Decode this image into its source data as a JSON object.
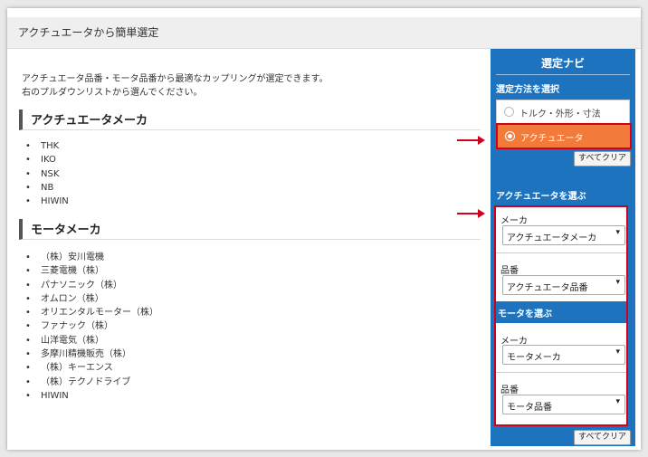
{
  "page": {
    "title": "アクチュエータから簡単選定",
    "intro_lines": [
      "アクチュエータ品番・モータ品番から最適なカップリングが選定できます。",
      "右のプルダウンリストから選んでください。"
    ]
  },
  "actuator_makers": {
    "heading": "アクチュエータメーカ",
    "items": [
      "THK",
      "IKO",
      "NSK",
      "NB",
      "HIWIN"
    ]
  },
  "motor_makers": {
    "heading": "モータメーカ",
    "items": [
      "（株）安川電機",
      "三菱電機（株）",
      "パナソニック（株）",
      "オムロン（株）",
      "オリエンタルモーター（株）",
      "ファナック（株）",
      "山洋電気（株）",
      "多摩川精機販売（株）",
      "（株）キーエンス",
      "（株）テクノドライブ",
      "HIWIN"
    ]
  },
  "nav": {
    "title": "選定ナビ",
    "method_heading": "選定方法を選択",
    "method_options": [
      "トルク・外形・寸法",
      "アクチュエータ"
    ],
    "selected_method": "アクチュエータ",
    "clear_label": "すべてクリア",
    "actuator_heading": "アクチュエータを選ぶ",
    "actuator_maker_label": "メーカ",
    "actuator_maker_value": "アクチュエータメーカ",
    "actuator_part_label": "品番",
    "actuator_part_value": "アクチュエータ品番",
    "motor_heading": "モータを選ぶ",
    "motor_maker_label": "メーカ",
    "motor_maker_value": "モータメーカ",
    "motor_part_label": "品番",
    "motor_part_value": "モータ品番"
  },
  "colors": {
    "panel_blue": "#1e73be",
    "selected_orange": "#f27b3c",
    "highlight_red": "#d0021b"
  }
}
